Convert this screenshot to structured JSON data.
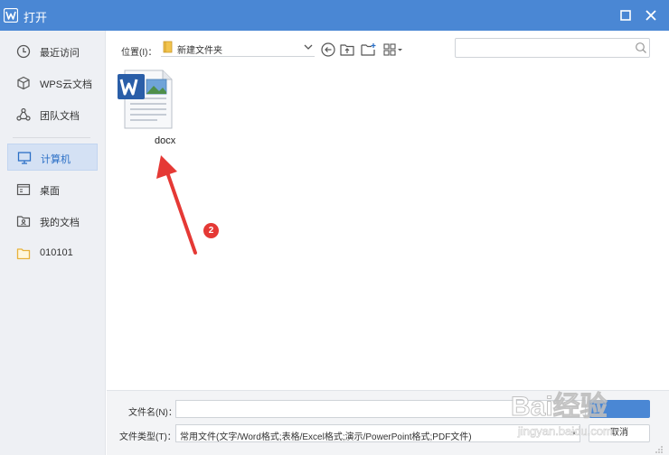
{
  "titlebar": {
    "title": "打开"
  },
  "sidebar": {
    "items": [
      {
        "label": "最近访问",
        "icon": "clock-icon"
      },
      {
        "label": "WPS云文档",
        "icon": "cube-icon"
      },
      {
        "label": "团队文档",
        "icon": "team-icon"
      },
      {
        "label": "计算机",
        "icon": "monitor-icon",
        "selected": true
      },
      {
        "label": "桌面",
        "icon": "desktop-icon"
      },
      {
        "label": "我的文档",
        "icon": "my-documents-icon"
      },
      {
        "label": "010101",
        "icon": "folder-icon"
      }
    ]
  },
  "toolbar": {
    "location_label": "位置(I)：",
    "location_value": "新建文件夹",
    "search_placeholder": ""
  },
  "files": [
    {
      "name": "docx",
      "icon": "word-document-icon"
    }
  ],
  "annotation": {
    "badge": "2",
    "arrow_color": "#e53935"
  },
  "bottom": {
    "filename_label": "文件名(N)：",
    "filename_value": "",
    "filetype_label": "文件类型(T)：",
    "filetype_value": "常用文件(文字/Word格式;表格/Excel格式;演示/PowerPoint格式;PDF文件)",
    "open_label": "",
    "cancel_label": "取消"
  },
  "watermark": {
    "text": "Bai经验",
    "subtext": "jingyan.baidu.com"
  },
  "colors": {
    "titlebar": "#4a87d4",
    "selected_bg": "#d4e1f4",
    "badge": "#e53935",
    "sidebar_bg": "#eef0f4"
  }
}
